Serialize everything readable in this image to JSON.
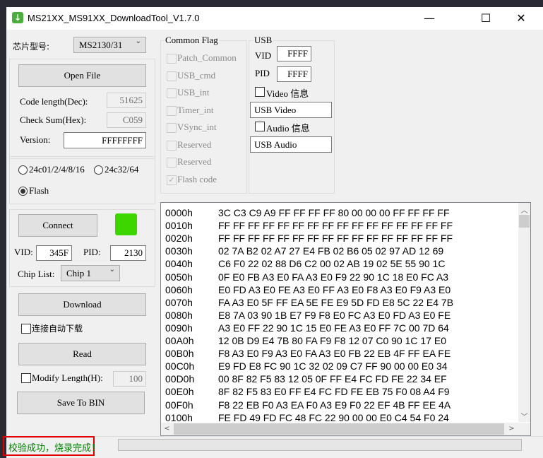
{
  "window": {
    "title": "MS21XX_MS91XX_DownloadTool_V1.7.0",
    "minimize_icon": "minimize-icon",
    "maximize_icon": "maximize-icon",
    "close_icon": "close-icon",
    "min": "—",
    "max": "☐",
    "close": "✕"
  },
  "chip": {
    "label": "芯片型号:",
    "selected": "MS2130/31"
  },
  "file": {
    "open_label": "Open File",
    "code_length_label": "Code length(Dec):",
    "code_length": "51625",
    "checksum_label": "Check Sum(Hex):",
    "checksum": "C059",
    "version_label": "Version:",
    "version": "FFFFFFFF"
  },
  "eeprom": {
    "options": [
      "24c01/2/4/8/16",
      "24c32/64",
      "Flash"
    ],
    "selected": "Flash"
  },
  "connect": {
    "label": "Connect",
    "status_color": "#3ed600",
    "vid_label": "VID:",
    "vid": "345F",
    "pid_label": "PID:",
    "pid": "2130",
    "chip_list_label": "Chip List:",
    "chip_list_selected": "Chip 1"
  },
  "actions": {
    "download": "Download",
    "auto_download": "连接自动下载",
    "read": "Read",
    "modify_length_label": "Modify  Length(H):",
    "modify_length": "100",
    "save": "Save To BIN"
  },
  "common_flag": {
    "title": "Common Flag",
    "items": [
      {
        "label": "Patch_Common",
        "checked": false
      },
      {
        "label": "USB_cmd",
        "checked": false
      },
      {
        "label": "USB_int",
        "checked": false
      },
      {
        "label": "Timer_int",
        "checked": false
      },
      {
        "label": "VSync_int",
        "checked": false
      },
      {
        "label": "Reserved",
        "checked": false
      },
      {
        "label": "Reserved",
        "checked": false
      },
      {
        "label": "Flash code",
        "checked": true
      }
    ]
  },
  "usb": {
    "title": "USB",
    "vid_label": "VID",
    "vid": "FFFF",
    "pid_label": "PID",
    "pid": "FFFF",
    "video_label": "Video 信息",
    "video_name": "USB Video",
    "audio_label": "Audio 信息",
    "audio_name": "USB Audio"
  },
  "hex": [
    {
      "addr": "0000h",
      "bytes": "3C C3 C9 A9 FF FF FF FF 80 00 00 00 FF FF FF FF"
    },
    {
      "addr": "0010h",
      "bytes": "FF FF FF FF FF FF FF FF FF FF FF FF FF FF FF FF"
    },
    {
      "addr": "0020h",
      "bytes": "FF FF FF FF FF FF FF FF FF FF FF FF FF FF FF FF"
    },
    {
      "addr": "0030h",
      "bytes": "02 7A B2 02 A7 27 E4 FB 02 B6 05 02 97 AD 12 69"
    },
    {
      "addr": "0040h",
      "bytes": "C6 F0 22 02 88 D6 C2 00 02 AB 19 02 5E 55 90 1C"
    },
    {
      "addr": "0050h",
      "bytes": "0F E0 FB A3 E0 FA A3 E0 F9 22 90 1C 18 E0 FC A3"
    },
    {
      "addr": "0060h",
      "bytes": "E0 FD A3 E0 FE A3 E0 FF A3 E0 F8 A3 E0 F9 A3 E0"
    },
    {
      "addr": "0070h",
      "bytes": "FA A3 E0 5F FF EA 5E FE E9 5D FD E8 5C 22 E4 7B"
    },
    {
      "addr": "0080h",
      "bytes": "E8 7A 03 90 1B E7 F9 F8 E0 FC A3 E0 FD A3 E0 FE"
    },
    {
      "addr": "0090h",
      "bytes": "A3 E0 FF 22 90 1C 15 E0 FE A3 E0 FF 7C 00 7D 64"
    },
    {
      "addr": "00A0h",
      "bytes": "12 0B D9 E4 7B 80 FA F9 F8 12 07 C0 90 1C 17 E0"
    },
    {
      "addr": "00B0h",
      "bytes": "F8 A3 E0 F9 A3 E0 FA A3 E0 FB 22 EB 4F FF EA FE"
    },
    {
      "addr": "00C0h",
      "bytes": "E9 FD E8 FC 90 1C 32 02 09 C7 FF 90 00 00 E0 34"
    },
    {
      "addr": "00D0h",
      "bytes": "00 8F 82 F5 83 12 05 0F FF E4 FC FD FE 22 34 EF"
    },
    {
      "addr": "00E0h",
      "bytes": "8F 82 F5 83 E0 FF E4 FC FD FE EB 75 F0 08 A4 F9"
    },
    {
      "addr": "00F0h",
      "bytes": "F8 22 EB F0 A3 EA F0 A3 E9 F0 22 EF 4B FF EE 4A"
    },
    {
      "addr": "0100h",
      "bytes": "FE FD 49 FD FC 48 FC 22 90 00 00 E0 C4 54 F0 24"
    }
  ],
  "status": {
    "message": "校验成功，烧录完成！",
    "message_color": "#008000",
    "progress": 0
  }
}
